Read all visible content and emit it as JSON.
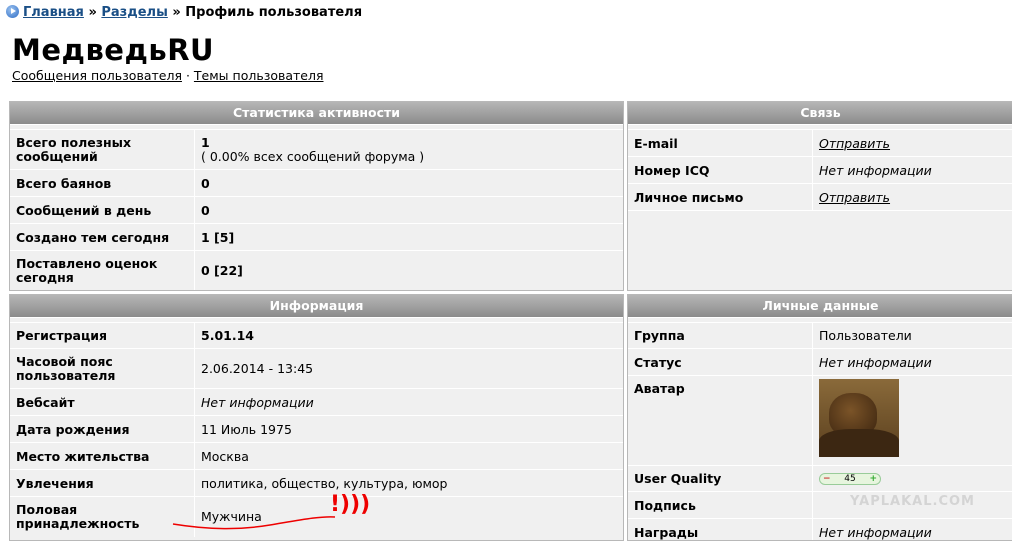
{
  "breadcrumb": {
    "home": "Главная",
    "sep1": "»",
    "sections": "Разделы",
    "sep2": "»",
    "current": "Профиль пользователя"
  },
  "profile": {
    "username": "МедведьRU",
    "posts_link": "Сообщения пользователя",
    "dot": "·",
    "topics_link": "Темы пользователя"
  },
  "activity": {
    "title": "Статистика активности",
    "rows": [
      {
        "label": "Всего полезных сообщений",
        "value": "1",
        "note": "( 0.00% всех сообщений форума )"
      },
      {
        "label": "Всего баянов",
        "value": "0"
      },
      {
        "label": "Сообщений в день",
        "value": "0"
      },
      {
        "label": "Создано тем сегодня",
        "value": "1 [5]"
      },
      {
        "label": "Поставлено оценок сегодня",
        "value": "0 [22]"
      }
    ]
  },
  "contact": {
    "title": "Связь",
    "rows": [
      {
        "label": "E-mail",
        "value": "Отправить"
      },
      {
        "label": "Номер ICQ",
        "value": "Нет информации"
      },
      {
        "label": "Личное письмо",
        "value": "Отправить"
      }
    ]
  },
  "info": {
    "title": "Информация",
    "rows": [
      {
        "label": "Регистрация",
        "value": "5.01.14"
      },
      {
        "label": "Часовой пояс пользователя",
        "value": "2.06.2014 - 13:45"
      },
      {
        "label": "Вебсайт",
        "value": "Нет информации"
      },
      {
        "label": "Дата рождения",
        "value": "11 Июль 1975"
      },
      {
        "label": "Место жительства",
        "value": "Москва"
      },
      {
        "label": "Увлечения",
        "value": "политика, общество, культура, юмор"
      },
      {
        "label": "Половая принадлежность",
        "value": "Мужчина"
      }
    ]
  },
  "personal": {
    "title": "Личные данные",
    "rows": [
      {
        "label": "Группа",
        "value": "Пользователи"
      },
      {
        "label": "Статус",
        "value": "Нет информации"
      },
      {
        "label": "Аватар",
        "value": ""
      },
      {
        "label": "User Quality",
        "value": "45",
        "minus": "−",
        "plus": "+"
      },
      {
        "label": "Подпись",
        "value": ""
      },
      {
        "label": "Награды",
        "value": "Нет информации"
      }
    ]
  },
  "annotation": {
    "text": "!)))",
    "color": "#e00000"
  },
  "watermark": "YAPLAKAL.COM"
}
